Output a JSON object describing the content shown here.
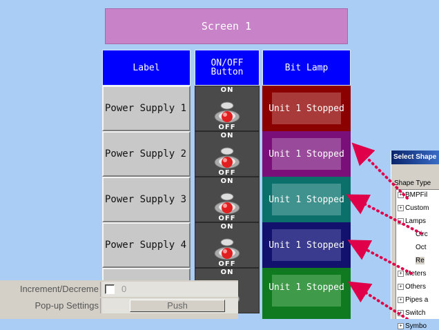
{
  "screen": {
    "title": "Screen 1"
  },
  "table": {
    "headers": {
      "label": "Label",
      "switch": "ON/OFF\nButton",
      "lamp": "Bit Lamp"
    },
    "rows": [
      {
        "label": "Power Supply 1",
        "lamp_text": "Unit 1 Stopped",
        "lamp_color": "#8b0000"
      },
      {
        "label": "Power Supply 2",
        "lamp_text": "Unit 1 Stopped",
        "lamp_color": "#7a0f7a"
      },
      {
        "label": "Power Supply 3",
        "lamp_text": "Unit 1 Stopped",
        "lamp_color": "#0b6f6a"
      },
      {
        "label": "Power Supply 4",
        "lamp_text": "Unit 1 Stopped",
        "lamp_color": "#12126e"
      },
      {
        "label": "",
        "lamp_text": "Unit 1 Stopped",
        "lamp_color": "#0f7a1f"
      }
    ],
    "switch": {
      "on_label": "ON",
      "off_label": "OFF",
      "icon": "toggle-switch-icon"
    }
  },
  "properties": {
    "rows": [
      {
        "name": "Increment/Decreme",
        "value": "0",
        "checked": false
      },
      {
        "name": "Pop-up Settings",
        "button": "Push"
      }
    ]
  },
  "select_shape_dialog": {
    "title": "Select Shape",
    "shape_type_label": "Shape Type",
    "tree": [
      {
        "text": "BMPFil",
        "expander": "+"
      },
      {
        "text": "Custom",
        "expander": "+"
      },
      {
        "text": "Lamps",
        "expander": "-"
      },
      {
        "text": "Circ",
        "expander": ""
      },
      {
        "text": "Oct",
        "expander": ""
      },
      {
        "text": "Re",
        "expander": ""
      },
      {
        "text": "Meters",
        "expander": "+"
      },
      {
        "text": "Others",
        "expander": "+"
      },
      {
        "text": "Pipes a",
        "expander": "+"
      },
      {
        "text": "Switch",
        "expander": "+"
      },
      {
        "text": "Symbo",
        "expander": "+"
      }
    ]
  },
  "colors": {
    "background": "#a9cdf4",
    "header_blue": "#0000ff",
    "title_pink": "#c882c8",
    "arrow_red": "#e0004a"
  }
}
